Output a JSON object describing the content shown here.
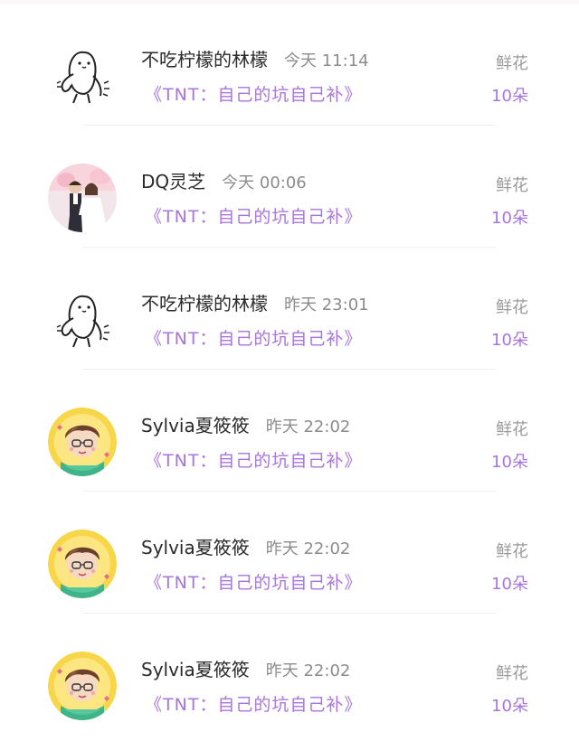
{
  "records": [
    {
      "user": "不吃柠檬的林檬",
      "time": "今天 11:14",
      "gift": "《TNT：自己的坑自己补》",
      "reward_label": "鲜花",
      "reward_count": "10朵",
      "avatar": "sketch-blob"
    },
    {
      "user": "DQ灵芝",
      "time": "今天 00:06",
      "gift": "《TNT：自己的坑自己补》",
      "reward_label": "鲜花",
      "reward_count": "10朵",
      "avatar": "photo-couple"
    },
    {
      "user": "不吃柠檬的林檬",
      "time": "昨天 23:01",
      "gift": "《TNT：自己的坑自己补》",
      "reward_label": "鲜花",
      "reward_count": "10朵",
      "avatar": "sketch-blob"
    },
    {
      "user": "Sylvia夏筱筱",
      "time": "昨天 22:02",
      "gift": "《TNT：自己的坑自己补》",
      "reward_label": "鲜花",
      "reward_count": "10朵",
      "avatar": "cartoon-boy"
    },
    {
      "user": "Sylvia夏筱筱",
      "time": "昨天 22:02",
      "gift": "《TNT：自己的坑自己补》",
      "reward_label": "鲜花",
      "reward_count": "10朵",
      "avatar": "cartoon-boy"
    },
    {
      "user": "Sylvia夏筱筱",
      "time": "昨天 22:02",
      "gift": "《TNT：自己的坑自己补》",
      "reward_label": "鲜花",
      "reward_count": "10朵",
      "avatar": "cartoon-boy"
    }
  ],
  "colors": {
    "accent": "#a874dd",
    "name_text": "#2a2a2a",
    "muted": "#8c8c8c"
  }
}
